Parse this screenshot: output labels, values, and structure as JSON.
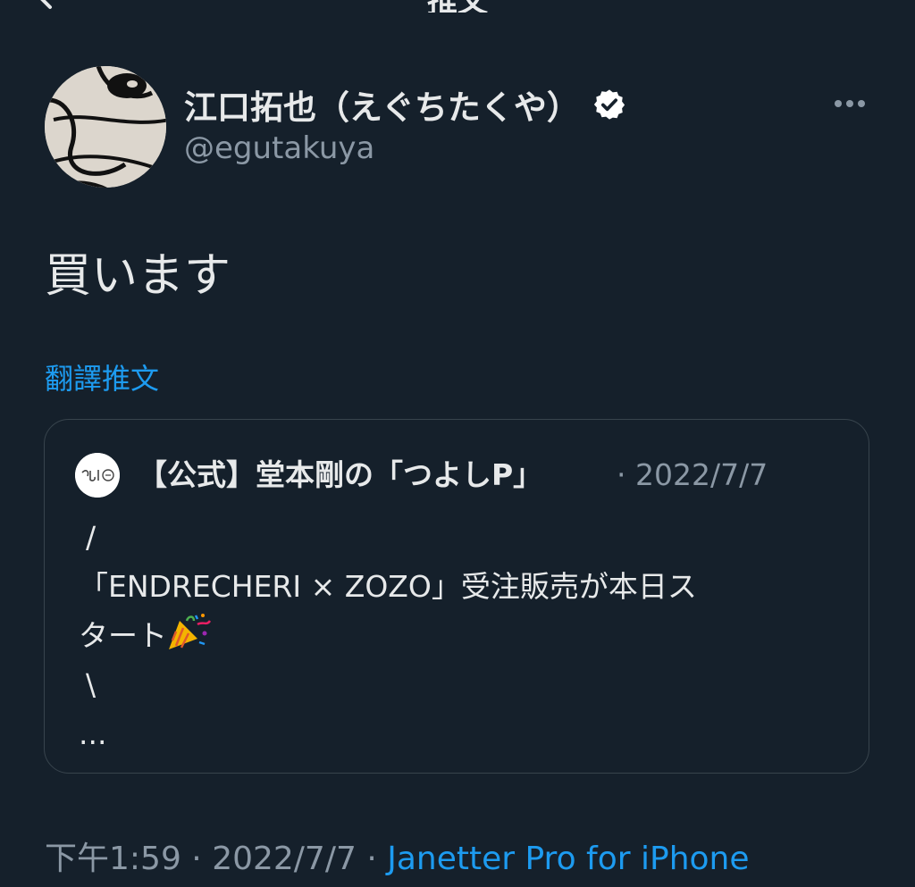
{
  "header": {
    "title": "推文"
  },
  "author": {
    "display_name": "江口拓也（えぐちたくや）",
    "handle": "@egutakuya"
  },
  "tweet": {
    "text": "買います",
    "translate_label": "翻譯推文"
  },
  "quoted": {
    "author_name": "【公式】堂本剛の「つよしP」",
    "date": "· 2022/7/7",
    "lines": [
      "/",
      "「ENDRECHERI × ZOZO」受注販売が本日ス",
      "タート",
      "\\",
      "..."
    ],
    "emoji": "party-popper"
  },
  "meta": {
    "time": "下午1:59",
    "sep1": " · ",
    "date": "2022/7/7",
    "sep2": " · ",
    "source": "Janetter Pro for iPhone"
  },
  "icons": {
    "verified": "verified-badge-icon",
    "more": "more-options-icon",
    "back": "back-arrow-icon"
  },
  "colors": {
    "background": "#15202b",
    "accent": "#1d9bf0",
    "secondary_text": "#8b98a5",
    "border": "#38444d"
  }
}
